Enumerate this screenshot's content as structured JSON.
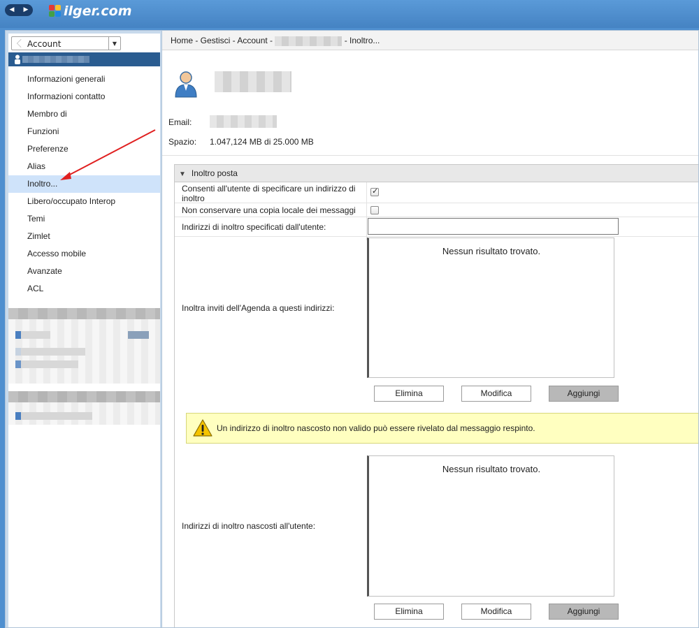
{
  "header": {
    "logo_text": "ilger.com",
    "nav_back": "◀",
    "nav_forward": "▶"
  },
  "sidebar": {
    "app_select_value": "Account",
    "items": [
      {
        "label": "Informazioni generali"
      },
      {
        "label": "Informazioni contatto"
      },
      {
        "label": "Membro di"
      },
      {
        "label": "Funzioni"
      },
      {
        "label": "Preferenze"
      },
      {
        "label": "Alias"
      },
      {
        "label": "Inoltro..."
      },
      {
        "label": "Libero/occupato Interop"
      },
      {
        "label": "Temi"
      },
      {
        "label": "Zimlet"
      },
      {
        "label": "Accesso mobile"
      },
      {
        "label": "Avanzate"
      },
      {
        "label": "ACL"
      }
    ],
    "selected_index": 6
  },
  "breadcrumb": {
    "part1": "Home - Gestisci - Account - ",
    "part2": " - Inoltro..."
  },
  "account_info": {
    "email_label": "Email:",
    "space_label": "Spazio:",
    "space_value": "1.047,124 MB di 25.000 MB"
  },
  "section": {
    "title": "Inoltro posta",
    "allow_user_label_line1": "Consenti all'utente di specificare un indirizzo di",
    "allow_user_label_line2": "inoltro",
    "allow_user_checked": true,
    "no_local_copy_label": "Non conservare una copia locale dei messaggi",
    "no_local_copy_checked": false,
    "user_addresses_label": "Indirizzi di inoltro specificati dall'utente:",
    "user_addresses_value": "",
    "calendar_label": "Inoltra inviti dell'Agenda a questi indirizzi:",
    "calendar_empty": "Nessun risultato trovato.",
    "hidden_label": "Indirizzi di inoltro nascosti all'utente:",
    "hidden_empty": "Nessun risultato trovato.",
    "warning_text": "Un indirizzo di inoltro nascosto non valido può essere rivelato dal messaggio respinto.",
    "btn_delete": "Elimina",
    "btn_edit": "Modifica",
    "btn_add": "Aggiungi"
  },
  "colors": {
    "topbar": "#4f8fcf",
    "selected_item": "#cfe3fa",
    "warning_bg": "#ffffc0",
    "annotation_arrow": "#e02020"
  }
}
